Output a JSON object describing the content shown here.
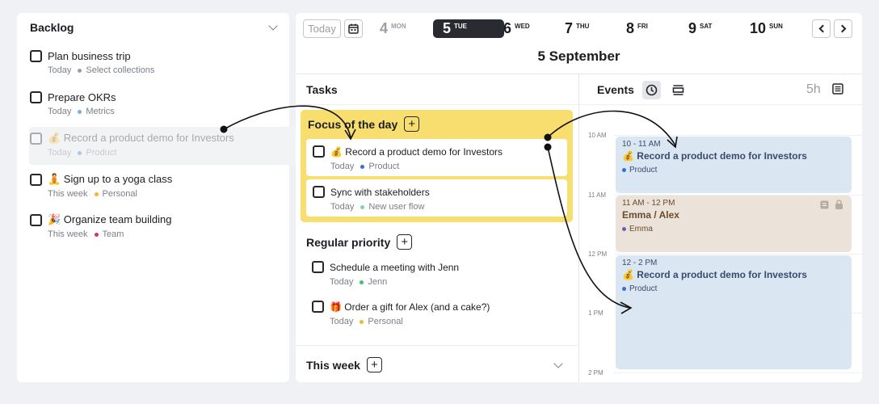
{
  "backlog": {
    "title": "Backlog",
    "items": [
      {
        "title": "Plan business trip",
        "when": "Today",
        "tag": "Select collections",
        "tag_color": "#9a9ea7"
      },
      {
        "title": "Prepare OKRs",
        "when": "Today",
        "tag": "Metrics",
        "tag_color": "#7aaee3"
      },
      {
        "title": "💰 Record a product demo for Investors",
        "when": "Today",
        "tag": "Product",
        "tag_color": "#2f6fde"
      },
      {
        "title": "🧘 Sign up to a yoga class",
        "when": "This week",
        "tag": "Personal",
        "tag_color": "#f0b82c"
      },
      {
        "title": "🎉 Organize team building",
        "when": "This week",
        "tag": "Team",
        "tag_color": "#d2356a"
      }
    ]
  },
  "header": {
    "today_label": "Today",
    "days": [
      {
        "num": "4",
        "wd": "MON"
      },
      {
        "num": "5",
        "wd": "TUE"
      },
      {
        "num": "6",
        "wd": "WED"
      },
      {
        "num": "7",
        "wd": "THU"
      },
      {
        "num": "8",
        "wd": "FRI"
      },
      {
        "num": "9",
        "wd": "SAT"
      },
      {
        "num": "10",
        "wd": "SUN"
      }
    ],
    "date_title": "5 September"
  },
  "tasks": {
    "title": "Tasks",
    "focus": {
      "label": "Focus of the day",
      "plus": "+",
      "items": [
        {
          "title": "💰 Record a product demo for Investors",
          "when": "Today",
          "tag": "Product",
          "tag_color": "#2f6fde"
        },
        {
          "title": "Sync with stakeholders",
          "when": "Today",
          "tag": "New user flow",
          "tag_color": "#7fd6a3"
        }
      ]
    },
    "regular": {
      "label": "Regular priority",
      "plus": "+",
      "items": [
        {
          "title": "Schedule a meeting with Jenn",
          "when": "Today",
          "tag": "Jenn",
          "tag_color": "#3fc172"
        },
        {
          "title": "🎁 Order a gift for Alex (and a cake?)",
          "when": "Today",
          "tag": "Personal",
          "tag_color": "#f0b82c"
        }
      ]
    },
    "this_week": {
      "label": "This week",
      "plus": "+"
    }
  },
  "events": {
    "title": "Events",
    "duration": "5h",
    "time_labels": [
      "10 AM",
      "11 AM",
      "12 PM",
      "1 PM",
      "2 PM"
    ],
    "items": [
      {
        "time": "10 - 11 AM",
        "title": "💰 Record a product demo for Investors",
        "tag": "Product",
        "tag_color": "#2f6fde",
        "bg": "#dbe6f3",
        "fg": "#3a4a6b"
      },
      {
        "time": "11 AM - 12 PM",
        "title": "Emma / Alex",
        "tag": "Emma",
        "tag_color": "#6e5bb3",
        "bg": "#ebe3d9",
        "fg": "#6b4a2a"
      },
      {
        "time": "12 - 2 PM",
        "title": "💰 Record a product demo for Investors",
        "tag": "Product",
        "tag_color": "#2f6fde",
        "bg": "#dbe6f3",
        "fg": "#3a4a6b"
      }
    ]
  }
}
